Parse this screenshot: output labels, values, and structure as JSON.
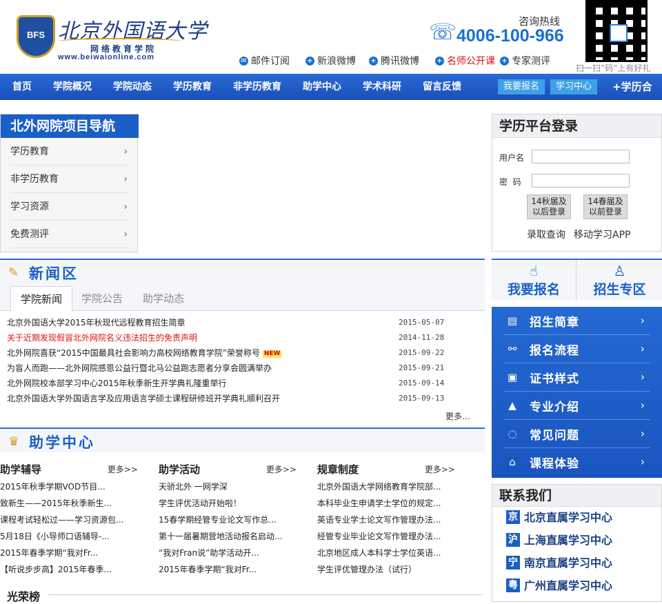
{
  "header": {
    "logo_seal": "BFS",
    "logo_title": "北京外国语大学",
    "logo_subtitle": "网络教育学院",
    "logo_url": "www.beiwaionline.com",
    "hotline_label": "咨询热线",
    "hotline_number": "4006-100-966",
    "qr_caption": "扫一扫”码”上有好礼",
    "quick_links": [
      "邮件订阅",
      "新浪微博",
      "腾讯微博",
      "名师公开课",
      "专家测评"
    ]
  },
  "nav": {
    "items": [
      "首页",
      "学院概况",
      "学院动态",
      "学历教育",
      "非学历教育",
      "助学中心",
      "学术科研",
      "留言反馈"
    ],
    "pill_register": "我要报名",
    "pill_study": "学习中心",
    "coop": "+学历合作"
  },
  "project_nav": {
    "title": "北外网院项目导航",
    "items": [
      "学历教育",
      "非学历教育",
      "学习资源",
      "免费测评"
    ]
  },
  "login": {
    "title": "学历平台登录",
    "username_label": "用户名",
    "password_label": "密  码",
    "btn_new": "14秋届及以后登录",
    "btn_old": "14春届及以前登录",
    "link_admission": "录取查询",
    "link_app": "移动学习APP"
  },
  "news": {
    "title": "新闻区",
    "tabs": [
      "学院新闻",
      "学院公告",
      "助学动态"
    ],
    "items": [
      {
        "text": "北京外国语大学2015年秋现代远程教育招生简章",
        "date": "2015-05-07"
      },
      {
        "text": "关于近期发现假冒北外网院名义违法招生的免责声明",
        "date": "2014-11-28"
      },
      {
        "text": "北外网院喜获“2015中国最具社会影响力高校网络教育学院”荣誉称号",
        "date": "2015-09-22",
        "badge": "NEW"
      },
      {
        "text": "为盲人而跑——北外网院感恩公益行暨北马公益跑志愿者分享会圆满举办",
        "date": "2015-09-21"
      },
      {
        "text": "北外网院校本部学习中心2015年秋季新生开学典礼隆重举行",
        "date": "2015-09-14"
      },
      {
        "text": "北京外国语大学外国语言学及应用语言学硕士课程研修班开学典礼顺利召开",
        "date": "2015-09-13"
      }
    ],
    "more": "更多…"
  },
  "help": {
    "title": "助学中心",
    "more": "更多>>",
    "columns": [
      {
        "title": "助学辅导",
        "items": [
          "2015年秋季学期VOD节目...",
          "致新生——2015年秋季新生...",
          "课程考试轻松过——学习资源包...",
          "5月18日《小导师口语辅导-...",
          "2015年春季学期“我对Fr...",
          "【听说步步高】2015年春季..."
        ]
      },
      {
        "title": "助学活动",
        "items": [
          "天骄北外 一网学深",
          "学生评优活动开始啦！",
          "15春学期经管专业论文写作总...",
          "第十一届暑期营地活动报名启动...",
          "“我对Fran说”助学活动开...",
          "2015年春季学期“我对Fr..."
        ]
      },
      {
        "title": "规章制度",
        "items": [
          "北京外国语大学网络教育学院部...",
          "本科毕业生申请学士学位的规定...",
          "英语专业学士论文写作管理办法...",
          "经管专业毕业论文写作管理办法...",
          "北京地区成人本科学士学位英语...",
          "学生评优管理办法（试行）"
        ]
      }
    ],
    "honor": "光荣榜"
  },
  "side": {
    "register": "我要报名",
    "zone": "招生专区",
    "panel": [
      "招生简章",
      "报名流程",
      "证书样式",
      "专业介绍",
      "常见问题",
      "课程体验"
    ],
    "contact_title": "联系我们",
    "contacts": [
      {
        "abbr": "京",
        "name": "北京直属学习中心"
      },
      {
        "abbr": "沪",
        "name": "上海直属学习中心"
      },
      {
        "abbr": "宁",
        "name": "南京直属学习中心"
      },
      {
        "abbr": "粤",
        "name": "广州直属学习中心"
      }
    ]
  },
  "colors": {
    "brand_blue": "#1a5fc7",
    "link_red": "#dd1111",
    "pill": "#3fa0ea"
  },
  "icons": [
    "mail-icon",
    "plus-icon",
    "phone-icon",
    "hand-icon",
    "person-icon",
    "chevron-right-icon"
  ]
}
